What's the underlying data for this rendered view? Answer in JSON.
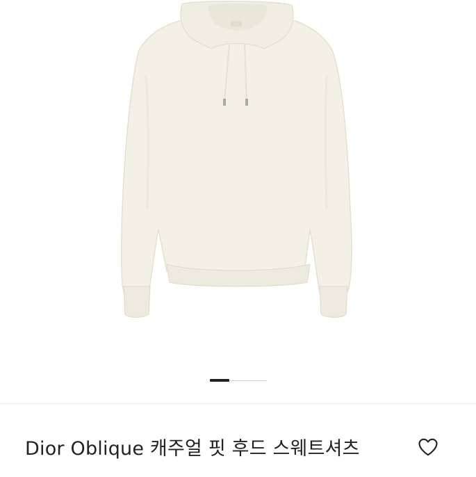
{
  "product": {
    "title": "Dior Oblique 캐주얼 핏 후드 스웨트셔츠"
  },
  "gallery": {
    "image_subject": "ivory hooded sweatshirt",
    "active_slide": 1,
    "slide_count": 3
  },
  "icons": {
    "wishlist": "heart-outline-icon"
  },
  "colors": {
    "hoodie": "#f4f0e6",
    "text": "#222222",
    "indicator_active": "#222222",
    "indicator_track": "#d0d0d0"
  }
}
